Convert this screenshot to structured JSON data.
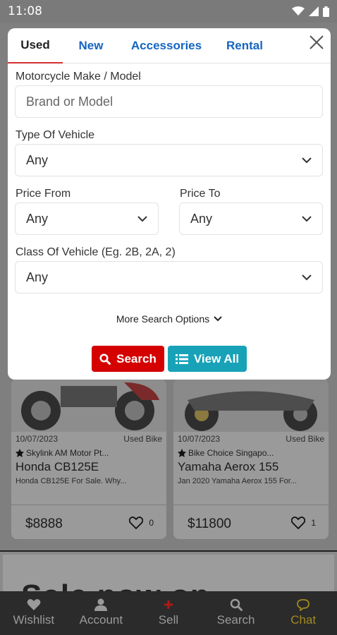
{
  "status_bar": {
    "time": "11:08"
  },
  "background": {
    "cards": [
      {
        "date": "10/07/2023",
        "type": "Used Bike",
        "seller": "Skylink AM Motor Pt...",
        "title": "Honda CB125E",
        "desc": "Honda CB125E For Sale. Why...",
        "price": "$8888",
        "likes": "0"
      },
      {
        "date": "10/07/2023",
        "type": "Used Bike",
        "seller": "Bike Choice Singapo...",
        "title": "Yamaha Aerox 155",
        "desc": "Jan 2020 Yamaha Aerox 155 For...",
        "price": "$11800",
        "likes": "1"
      }
    ],
    "banner_text": "Sale now on"
  },
  "modal": {
    "tabs": [
      {
        "label": "Used",
        "active": true
      },
      {
        "label": "New",
        "active": false
      },
      {
        "label": "Accessories",
        "active": false
      },
      {
        "label": "Rental",
        "active": false
      }
    ],
    "make_model": {
      "label": "Motorcycle Make / Model",
      "placeholder": "Brand or Model"
    },
    "vehicle_type": {
      "label": "Type Of Vehicle",
      "value": "Any"
    },
    "price_from": {
      "label": "Price From",
      "value": "Any"
    },
    "price_to": {
      "label": "Price To",
      "value": "Any"
    },
    "vehicle_class": {
      "label": "Class Of Vehicle (Eg. 2B, 2A, 2)",
      "value": "Any"
    },
    "more_options": "More Search Options",
    "search_button": "Search",
    "view_all_button": "View All"
  },
  "bottom_nav": [
    {
      "label": "Wishlist",
      "icon": "heart-icon"
    },
    {
      "label": "Account",
      "icon": "person-icon"
    },
    {
      "label": "Sell",
      "icon": "plus-icon"
    },
    {
      "label": "Search",
      "icon": "search-icon"
    },
    {
      "label": "Chat",
      "icon": "chat-icon"
    }
  ],
  "colors": {
    "accent_red": "#d50000",
    "teal": "#17a2b8",
    "tab_blue": "#1565c0",
    "chat_gold": "#a08a20"
  }
}
